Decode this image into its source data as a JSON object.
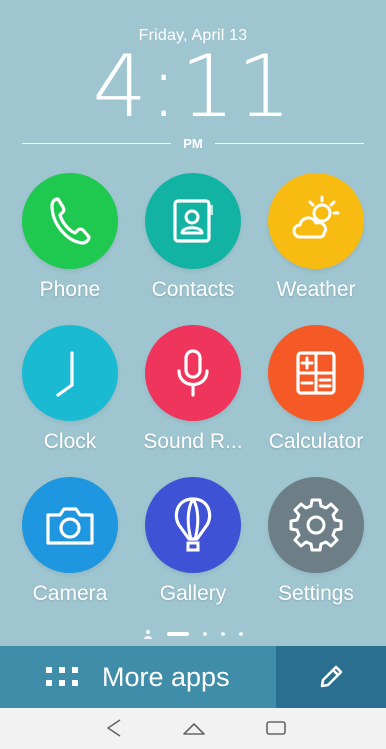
{
  "lockscreen": {
    "date": "Friday, April 13",
    "time_hour": "4",
    "time_colon": ":",
    "time_minutes": "11",
    "ampm": "PM"
  },
  "apps": [
    {
      "label": "Phone",
      "icon": "phone-icon",
      "color": "#1fc94f"
    },
    {
      "label": "Contacts",
      "icon": "contacts-icon",
      "color": "#13b3a3"
    },
    {
      "label": "Weather",
      "icon": "weather-icon",
      "color": "#f7bb12"
    },
    {
      "label": "Clock",
      "icon": "clock-icon",
      "color": "#1bbad3"
    },
    {
      "label": "Sound R...",
      "icon": "microphone-icon",
      "color": "#f0355c"
    },
    {
      "label": "Calculator",
      "icon": "calculator-icon",
      "color": "#f55a26"
    },
    {
      "label": "Camera",
      "icon": "camera-icon",
      "color": "#1e96e0"
    },
    {
      "label": "Gallery",
      "icon": "gallery-balloon-icon",
      "color": "#3f52d6"
    },
    {
      "label": "Settings",
      "icon": "gear-icon",
      "color": "#6d7e87"
    }
  ],
  "pager": {
    "pages": 5,
    "current": 1
  },
  "dock": {
    "more_apps_label": "More apps",
    "more_apps_icon": "grid-icon",
    "edit_icon": "pencil-icon",
    "bar_color": "#3f8da8",
    "edit_color": "#2b6f90"
  },
  "navbar": {
    "back_icon": "back-icon",
    "home_icon": "home-icon",
    "recents_icon": "recents-icon"
  }
}
